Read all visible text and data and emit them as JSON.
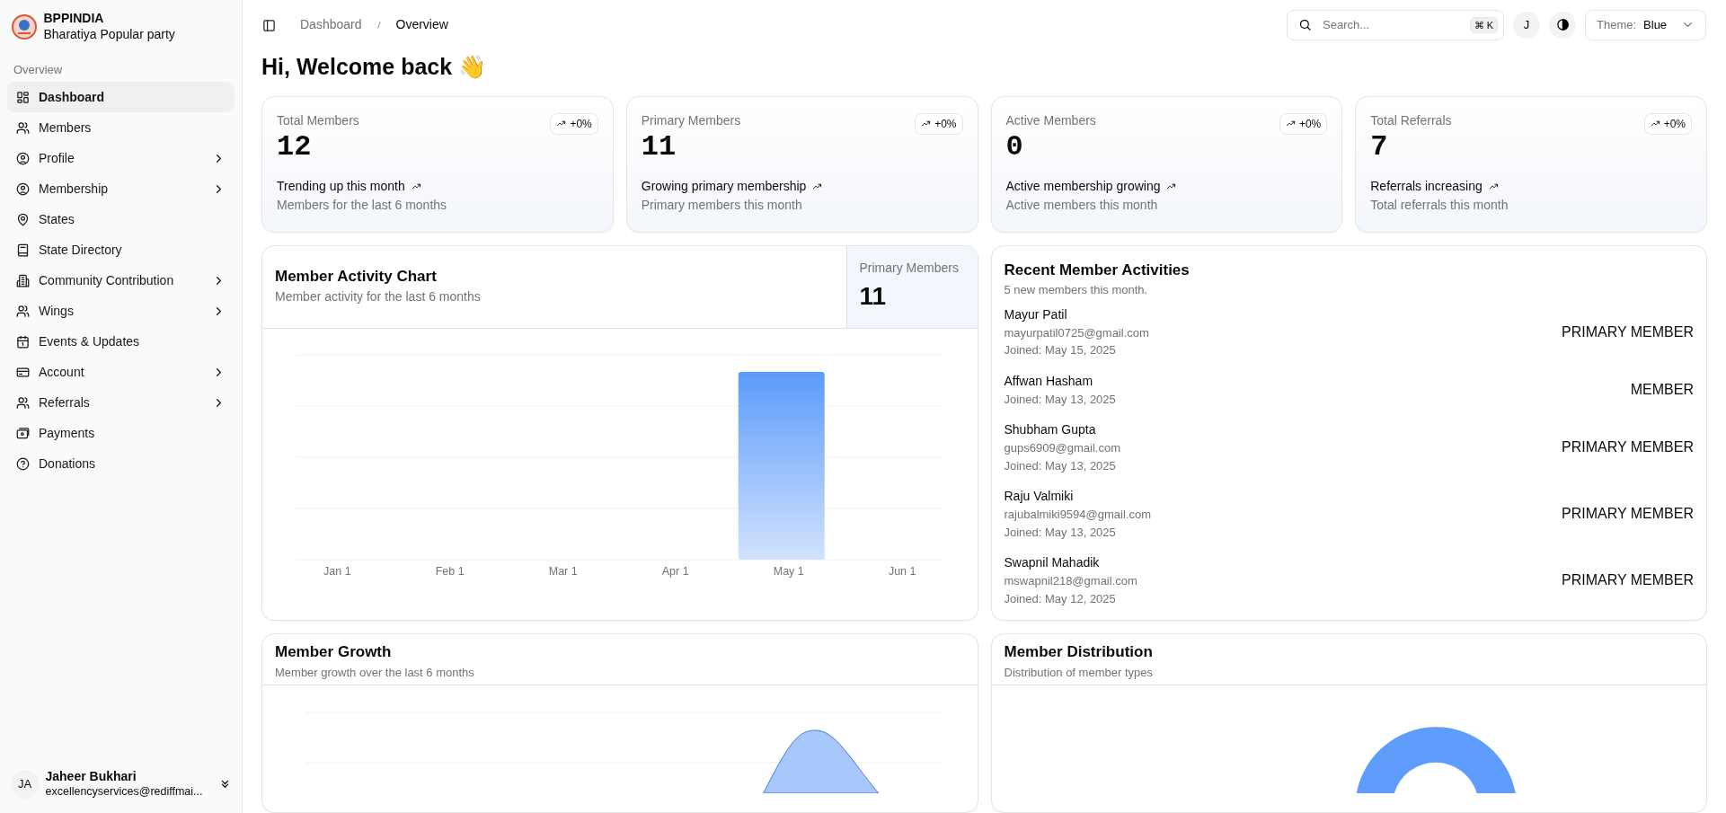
{
  "sidebar": {
    "brand": {
      "title": "BPPINDIA",
      "subtitle": "Bharatiya Popular party"
    },
    "section_label": "Overview",
    "items": [
      {
        "label": "Dashboard",
        "expandable": false,
        "selected": true
      },
      {
        "label": "Members",
        "expandable": false,
        "selected": false
      },
      {
        "label": "Profile",
        "expandable": true,
        "selected": false
      },
      {
        "label": "Membership",
        "expandable": true,
        "selected": false
      },
      {
        "label": "States",
        "expandable": false,
        "selected": false
      },
      {
        "label": "State Directory",
        "expandable": false,
        "selected": false
      },
      {
        "label": "Community Contribution",
        "expandable": true,
        "selected": false
      },
      {
        "label": "Wings",
        "expandable": true,
        "selected": false
      },
      {
        "label": "Events & Updates",
        "expandable": false,
        "selected": false
      },
      {
        "label": "Account",
        "expandable": true,
        "selected": false
      },
      {
        "label": "Referrals",
        "expandable": true,
        "selected": false
      },
      {
        "label": "Payments",
        "expandable": false,
        "selected": false
      },
      {
        "label": "Donations",
        "expandable": false,
        "selected": false
      }
    ],
    "user": {
      "initials": "JA",
      "name": "Jaheer Bukhari",
      "email": "excellencyservices@rediffmai..."
    }
  },
  "header": {
    "breadcrumb": [
      "Dashboard",
      "Overview"
    ],
    "search": {
      "placeholder": "Search...",
      "shortcut": "⌘",
      "shortcut_key": "K"
    },
    "avatar": "J",
    "theme": {
      "label": "Theme:",
      "value": "Blue"
    }
  },
  "greeting": "Hi, Welcome back 👋",
  "stats": [
    {
      "title": "Total Members",
      "value": "12",
      "badge": "+0%",
      "trend": "Trending up this month",
      "note": "Members for the last 6 months"
    },
    {
      "title": "Primary Members",
      "value": "11",
      "badge": "+0%",
      "trend": "Growing primary membership",
      "note": "Primary members this month"
    },
    {
      "title": "Active Members",
      "value": "0",
      "badge": "+0%",
      "trend": "Active membership growing",
      "note": "Active members this month"
    },
    {
      "title": "Total Referrals",
      "value": "7",
      "badge": "+0%",
      "trend": "Referrals increasing",
      "note": "Total referrals this month"
    }
  ],
  "activity_chart": {
    "title": "Member Activity Chart",
    "subtitle": "Member activity for the last 6 months",
    "stat_label": "Primary Members",
    "stat_value": "11",
    "axis_labels": [
      "Jan 1",
      "Feb 1",
      "Mar 1",
      "Apr 1",
      "May 1",
      "Jun 1"
    ]
  },
  "recent": {
    "title": "Recent Member Activities",
    "subtitle": "5 new members this month.",
    "members": [
      {
        "name": "Mayur Patil",
        "email": "mayurpatil0725@gmail.com",
        "joined": "Joined: May 15, 2025",
        "role": "PRIMARY MEMBER"
      },
      {
        "name": "Affwan Hasham",
        "joined": "Joined: May 13, 2025",
        "role": "MEMBER"
      },
      {
        "name": "Shubham Gupta",
        "email": "gups6909@gmail.com",
        "joined": "Joined: May 13, 2025",
        "role": "PRIMARY MEMBER"
      },
      {
        "name": "Raju Valmiki",
        "email": "rajubalmiki9594@gmail.com",
        "joined": "Joined: May 13, 2025",
        "role": "PRIMARY MEMBER"
      },
      {
        "name": "Swapnil Mahadik",
        "email": "mswapnil218@gmail.com",
        "joined": "Joined: May 12, 2025",
        "role": "PRIMARY MEMBER"
      }
    ]
  },
  "growth": {
    "title": "Member Growth",
    "subtitle": "Member growth over the last 6 months"
  },
  "distribution": {
    "title": "Member Distribution",
    "subtitle": "Distribution of member types"
  }
}
